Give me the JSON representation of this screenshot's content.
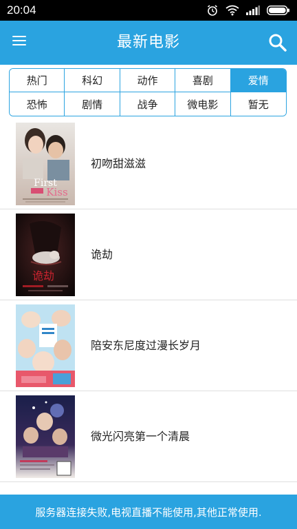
{
  "status_bar": {
    "time": "20:04",
    "icons": [
      "alarm-icon",
      "wifi-icon",
      "signal-icon",
      "battery-icon"
    ]
  },
  "app_bar": {
    "title": "最新电影",
    "menu_icon": "menu-icon",
    "search_icon": "search-icon"
  },
  "filters": {
    "items": [
      "热门",
      "科幻",
      "动作",
      "喜剧",
      "爱情",
      "恐怖",
      "剧情",
      "战争",
      "微电影",
      "暂无"
    ],
    "selected": "爱情"
  },
  "movies": [
    {
      "title": "初吻甜滋滋"
    },
    {
      "title": "诡劫"
    },
    {
      "title": "陪安东尼度过漫长岁月"
    },
    {
      "title": "微光闪亮第一个清晨"
    }
  ],
  "banner": {
    "message": "服务器连接失败,电视直播不能使用,其他正常使用."
  },
  "colors": {
    "accent": "#2aa3e0",
    "status_bar": "#000000"
  }
}
